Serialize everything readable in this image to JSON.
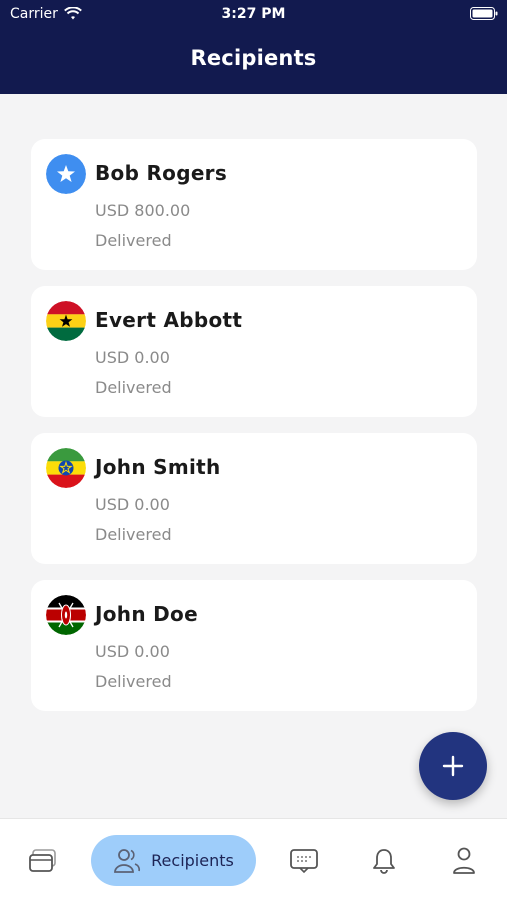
{
  "status_bar": {
    "carrier": "Carrier",
    "time": "3:27 PM"
  },
  "header": {
    "title": "Recipients"
  },
  "recipients": [
    {
      "name": "Bob Rogers",
      "amount": "USD 800.00",
      "status": "Delivered",
      "flag_icon": "star-icon"
    },
    {
      "name": "Evert Abbott",
      "amount": "USD 0.00",
      "status": "Delivered",
      "flag_icon": "ghana-flag-icon"
    },
    {
      "name": "John Smith",
      "amount": "USD 0.00",
      "status": "Delivered",
      "flag_icon": "ethiopia-flag-icon"
    },
    {
      "name": "John Doe",
      "amount": "USD 0.00",
      "status": "Delivered",
      "flag_icon": "kenya-flag-icon"
    }
  ],
  "fab": {
    "icon": "plus-icon"
  },
  "tabbar": {
    "active_label": "Recipients",
    "tabs": [
      "cards-icon",
      "recipients-icon",
      "messages-icon",
      "bell-icon",
      "profile-icon"
    ]
  },
  "colors": {
    "header_bg": "#121a4f",
    "fab_bg": "#22347f",
    "active_tab_bg": "#9ecdfa",
    "page_bg": "#f4f4f5"
  }
}
